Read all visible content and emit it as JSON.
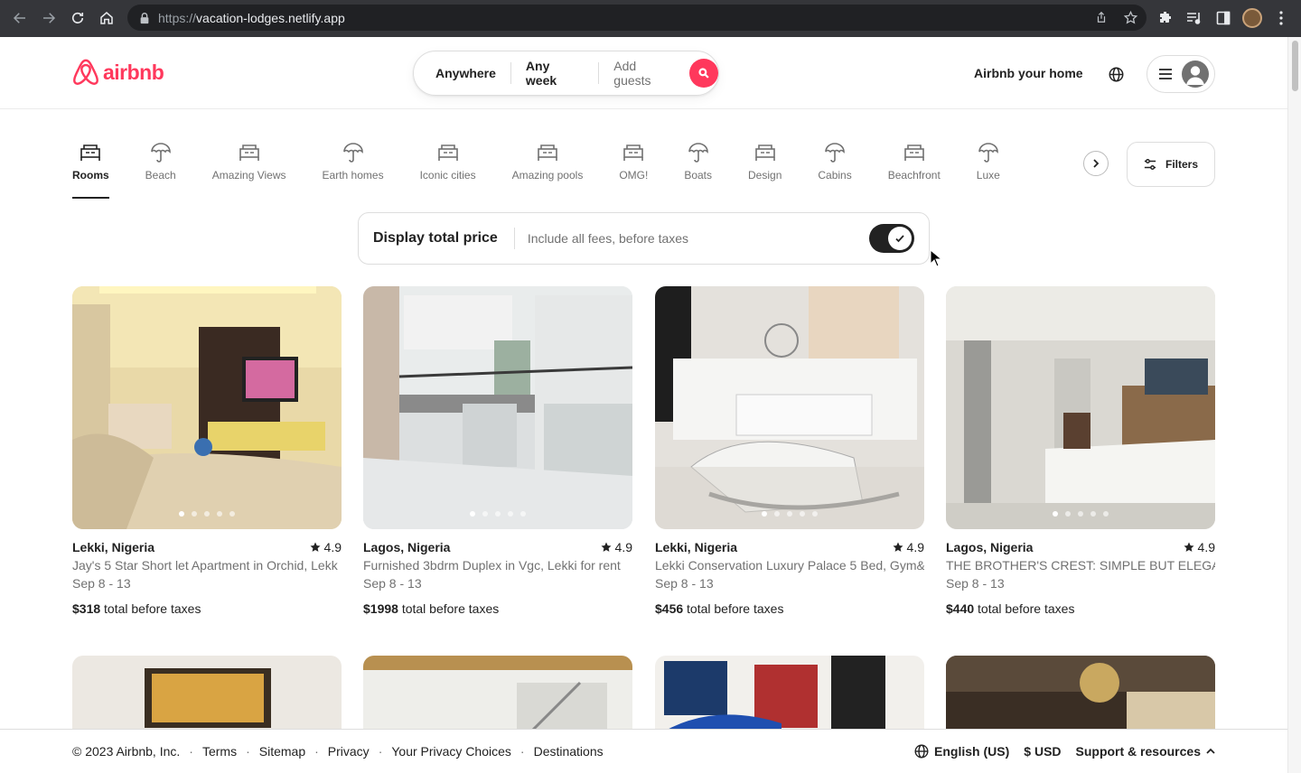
{
  "browser": {
    "url_scheme": "https://",
    "url_host": "vacation-lodges.netlify.app"
  },
  "header": {
    "brand": "airbnb",
    "search": {
      "where": "Anywhere",
      "when": "Any week",
      "guests": "Add guests"
    },
    "host_link": "Airbnb your home"
  },
  "categories": [
    {
      "label": "Rooms",
      "icon": "rooms-icon",
      "active": true
    },
    {
      "label": "Beach",
      "icon": "beach-umbrella-icon"
    },
    {
      "label": "Amazing Views",
      "icon": "amazing-views-icon"
    },
    {
      "label": "Earth homes",
      "icon": "earth-homes-icon"
    },
    {
      "label": "Iconic cities",
      "icon": "iconic-cities-icon"
    },
    {
      "label": "Amazing pools",
      "icon": "amazing-pools-icon"
    },
    {
      "label": "OMG!",
      "icon": "omg-icon"
    },
    {
      "label": "Boats",
      "icon": "boats-icon"
    },
    {
      "label": "Design",
      "icon": "design-icon"
    },
    {
      "label": "Cabins",
      "icon": "cabins-icon"
    },
    {
      "label": "Beachfront",
      "icon": "beachfront-icon"
    },
    {
      "label": "Luxe",
      "icon": "luxe-icon"
    }
  ],
  "filters_label": "Filters",
  "total_price": {
    "title": "Display total price",
    "subtitle": "Include all fees, before taxes",
    "enabled": true
  },
  "listings": [
    {
      "location": "Lekki, Nigeria",
      "rating": "4.9",
      "title": "Jay's 5 Star Short let Apartment in Orchid, Lekk",
      "dates": "Sep 8 - 13",
      "price": "$318",
      "price_suffix": "total before taxes"
    },
    {
      "location": "Lagos, Nigeria",
      "rating": "4.9",
      "title": "Furnished 3bdrm Duplex in Vgc, Lekki for rent",
      "dates": "Sep 8 - 13",
      "price": "$1998",
      "price_suffix": "total before taxes"
    },
    {
      "location": "Lekki, Nigeria",
      "rating": "4.9",
      "title": "Lekki Conservation Luxury Palace 5 Bed, Gym&",
      "dates": "Sep 8 - 13",
      "price": "$456",
      "price_suffix": "total before taxes"
    },
    {
      "location": "Lagos, Nigeria",
      "rating": "4.9",
      "title": "THE BROTHER'S CREST: SIMPLE BUT ELEGANT",
      "dates": "Sep 8 - 13",
      "price": "$440",
      "price_suffix": "total before taxes"
    }
  ],
  "footer": {
    "copyright": "© 2023 Airbnb, Inc.",
    "links": [
      "Terms",
      "Sitemap",
      "Privacy",
      "Your Privacy Choices",
      "Destinations"
    ],
    "language": "English (US)",
    "currency": "$ USD",
    "support": "Support & resources"
  },
  "colors": {
    "brand": "#ff385c",
    "text": "#222222",
    "muted": "#717171"
  }
}
